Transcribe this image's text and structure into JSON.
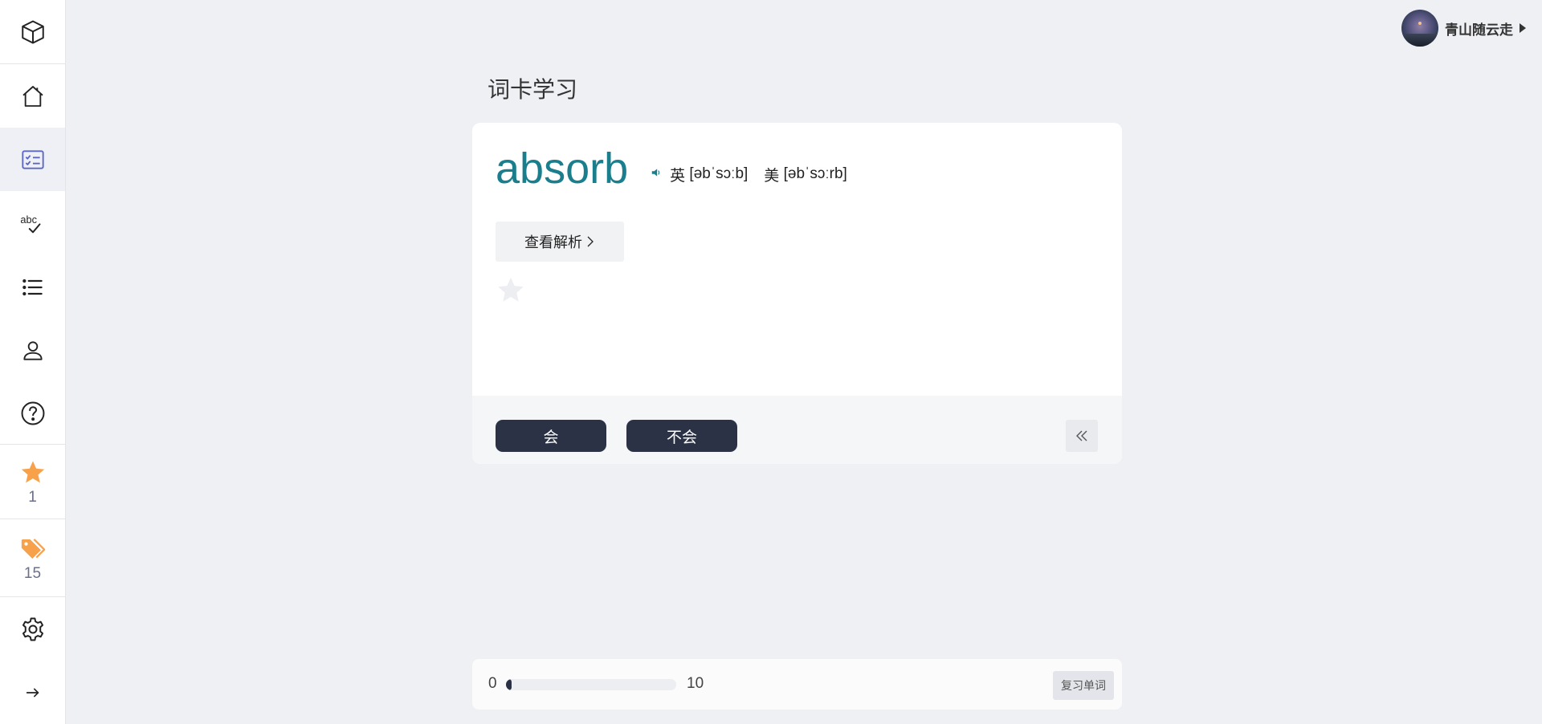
{
  "sidebar": {
    "items": [
      {
        "icon": "cube-icon"
      },
      {
        "icon": "home-icon"
      },
      {
        "icon": "checklist-icon",
        "active": true
      },
      {
        "icon": "spellcheck-icon"
      },
      {
        "icon": "list-icon"
      },
      {
        "icon": "user-icon"
      },
      {
        "icon": "help-icon"
      },
      {
        "icon": "star-icon",
        "count": "1"
      },
      {
        "icon": "tag-icon",
        "count": "15"
      },
      {
        "icon": "gear-icon"
      },
      {
        "icon": "arrow-right-icon"
      }
    ],
    "accent_color": "#5a67c9",
    "star_color": "#f7a14a",
    "tag_color": "#f7a14a"
  },
  "user": {
    "name": "青山随云走"
  },
  "page": {
    "title": "词卡学习"
  },
  "card": {
    "word": "absorb",
    "word_color": "#1a7e8c",
    "uk_label": "英",
    "uk_phonetic": "[əbˈsɔːb]",
    "us_label": "美",
    "us_phonetic": "[əbˈsɔːrb]",
    "analysis_label": "查看解析",
    "know_label": "会",
    "dont_know_label": "不会"
  },
  "progress": {
    "current": "0",
    "total": "10",
    "fraction": 0,
    "review_label": "复习单词"
  }
}
